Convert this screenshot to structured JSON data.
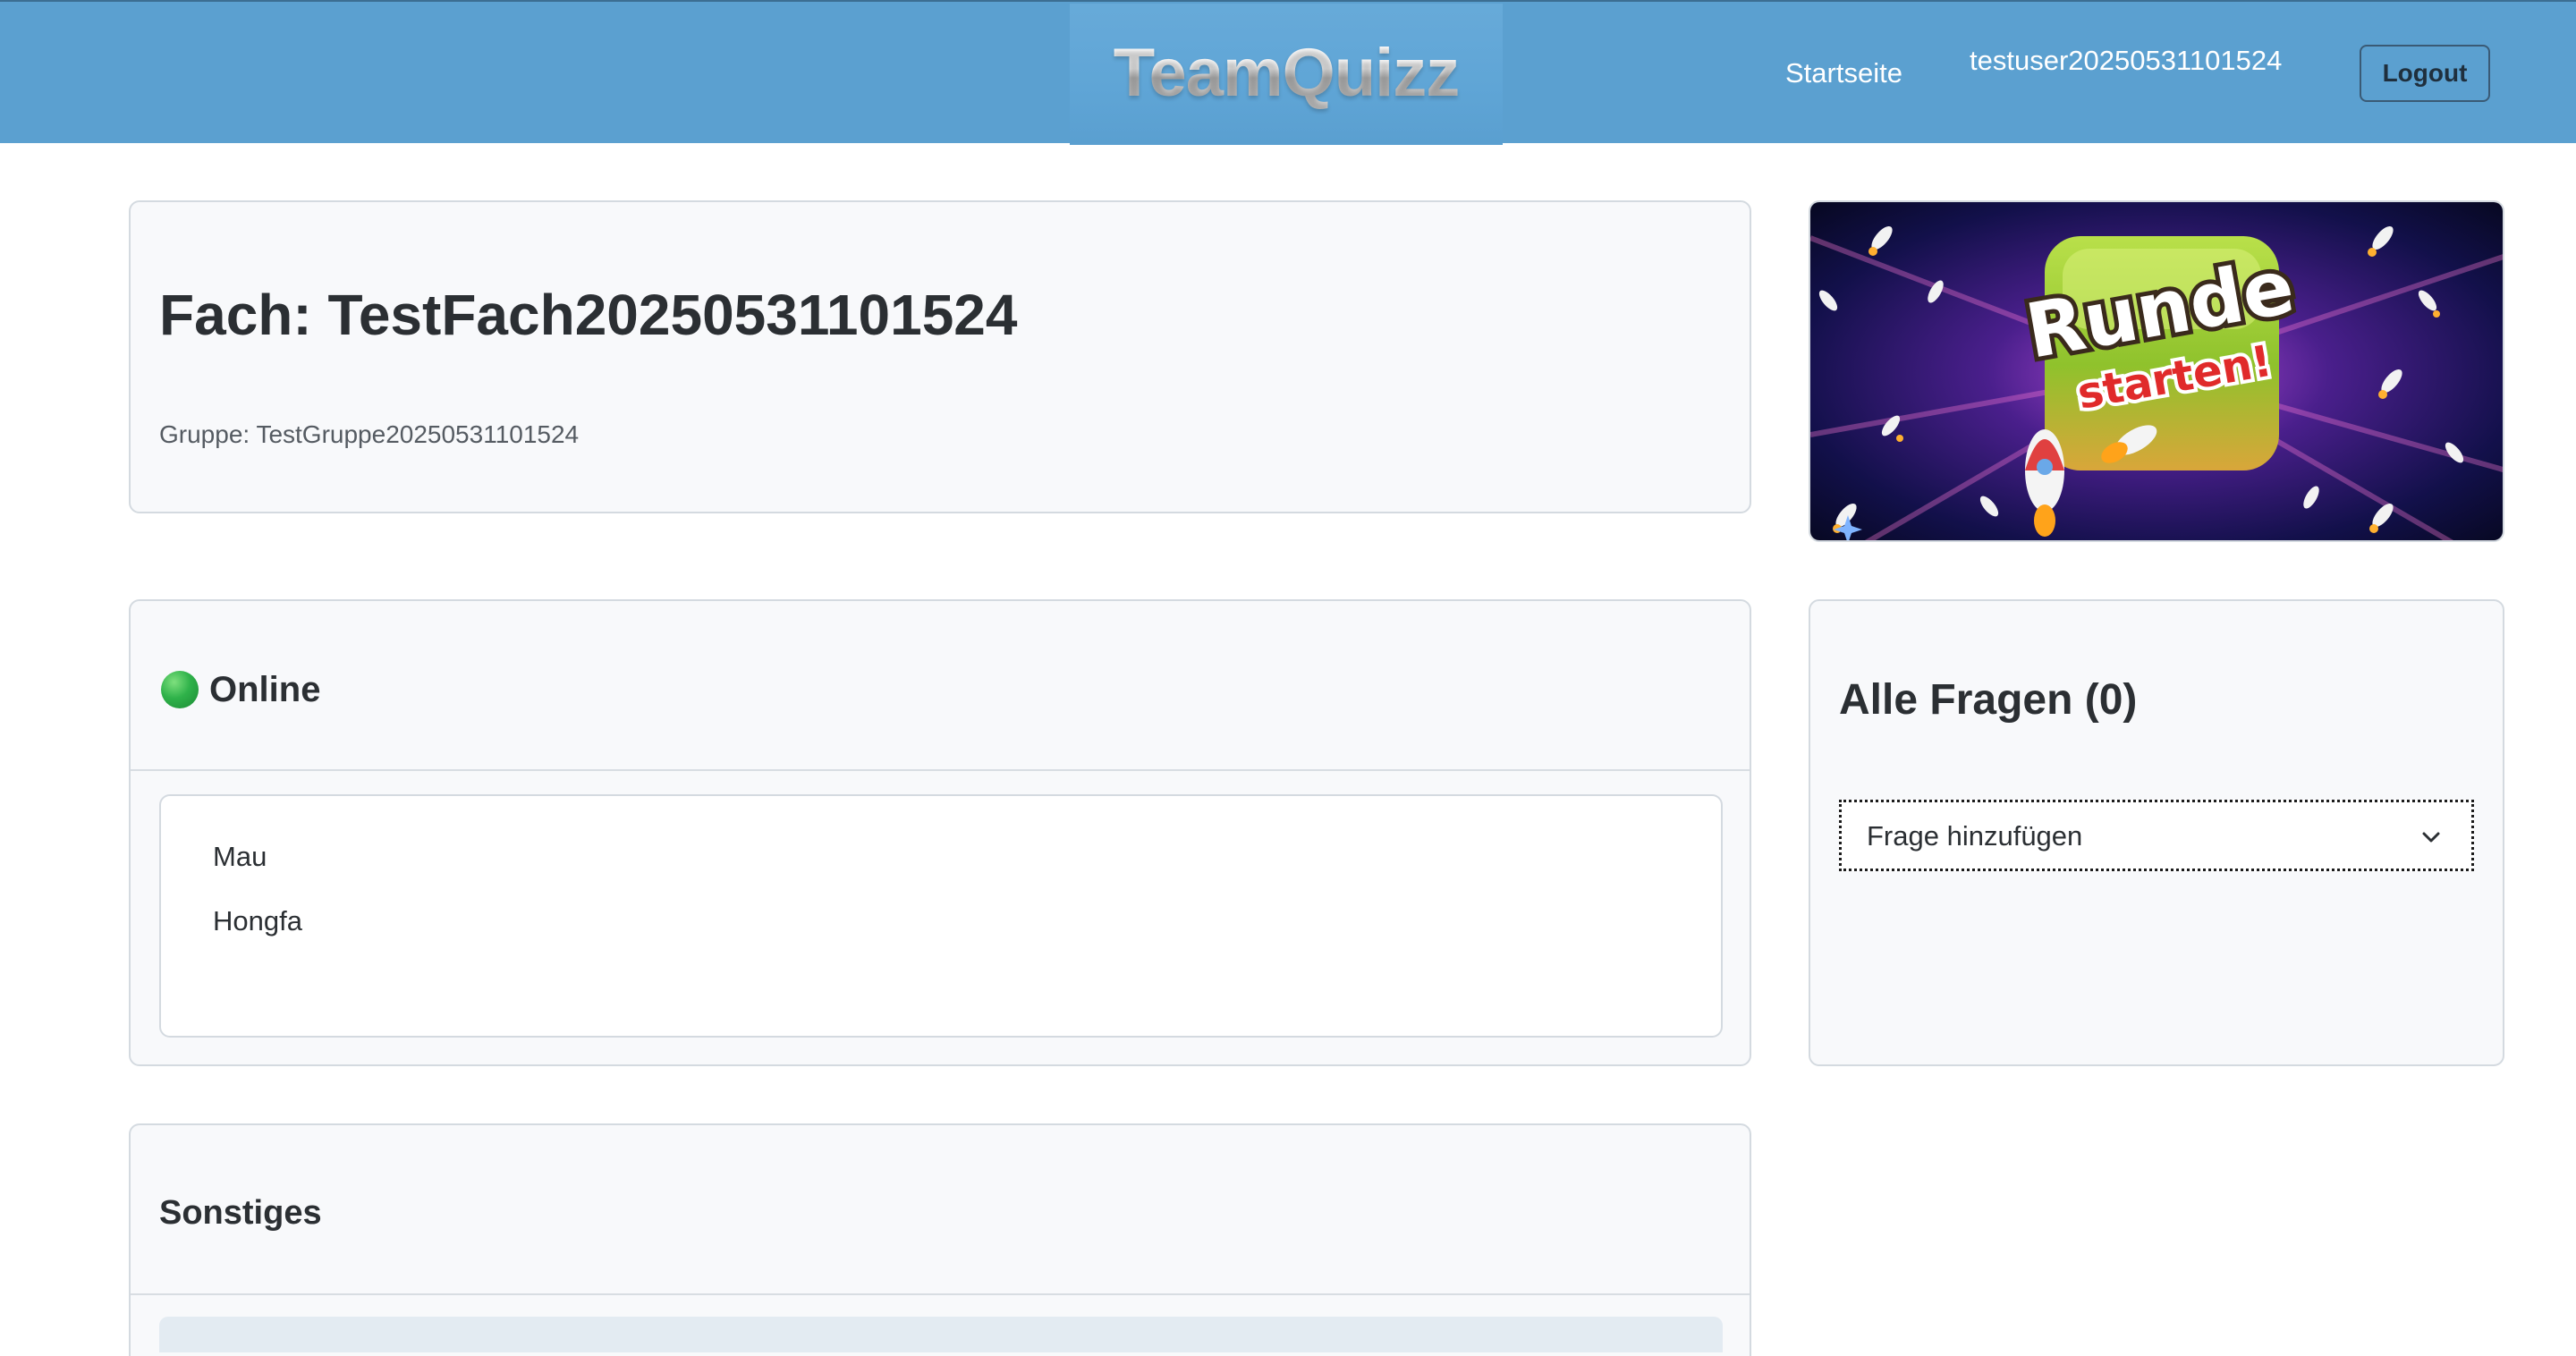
{
  "header": {
    "brand": "TeamQuizz",
    "nav_home": "Startseite",
    "username": "testuser20250531101524",
    "logout_label": "Logout",
    "background_color": "#5ba0d0"
  },
  "subject": {
    "title": "Fach: TestFach20250531101524",
    "group": "Gruppe: TestGruppe20250531101524"
  },
  "banner": {
    "line1": "Runde",
    "line2": "starten!",
    "icon": "rocket-icon"
  },
  "online": {
    "status_icon": "green-circle-icon",
    "title": "Online",
    "users": [
      "Mau",
      "Hongfa"
    ]
  },
  "questions": {
    "title": "Alle Fragen (0)",
    "add_select_label": "Frage hinzufügen",
    "icon": "chevron-down-icon"
  },
  "misc": {
    "title": "Sonstiges"
  }
}
